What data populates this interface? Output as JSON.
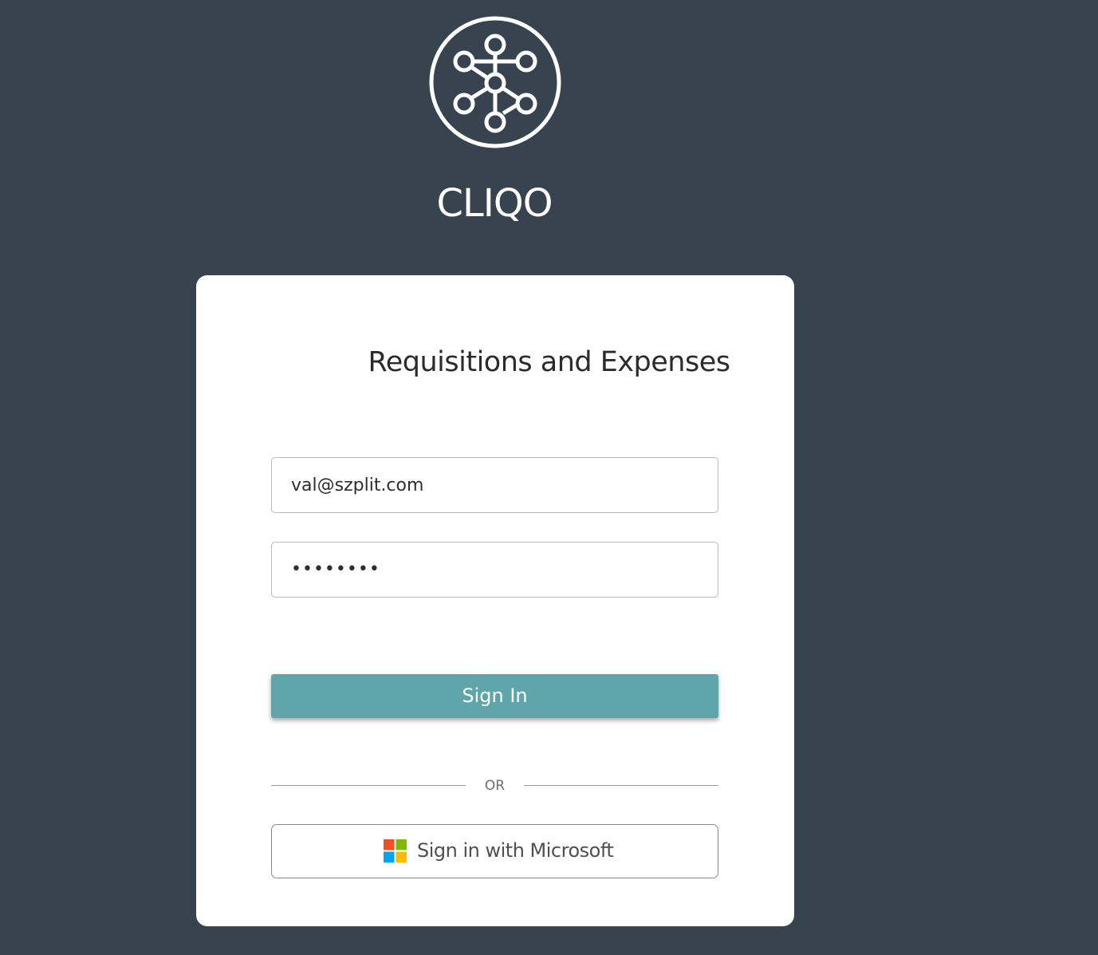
{
  "brand": {
    "name": "CLIQO",
    "logo_icon": "network-nodes-icon"
  },
  "login": {
    "title": "Requisitions and Expenses",
    "email_value": "val@szplit.com",
    "password_value": "••••••••",
    "sign_in_label": "Sign In",
    "divider_label": "OR",
    "microsoft_label": "Sign in with Microsoft",
    "microsoft_icon": "microsoft-logo-icon"
  },
  "colors": {
    "background": "#37444f",
    "primary_button": "#60a5a9",
    "card": "#ffffff"
  }
}
